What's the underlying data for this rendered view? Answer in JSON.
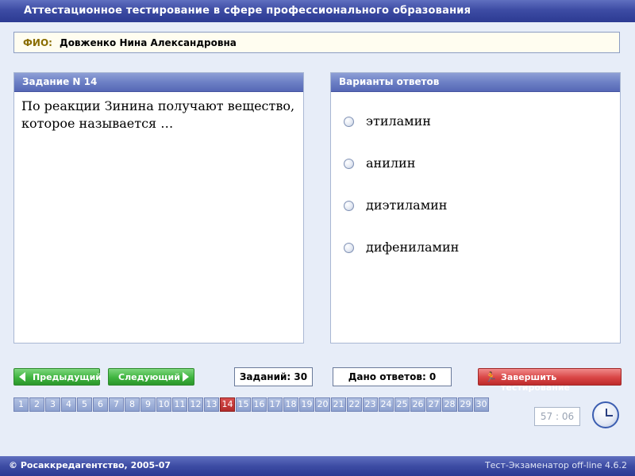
{
  "title": "Аттестационное тестирование в сфере профессионального образования",
  "fio": {
    "label": "ФИО:",
    "value": "Довженко Нина Александровна"
  },
  "question_panel": {
    "header": "Задание N 14",
    "text": "По реакции Зинина  получают вещество, которое называется …"
  },
  "answers_panel": {
    "header": "Варианты ответов",
    "options": [
      "этиламин",
      "анилин",
      "диэтиламин",
      "дифениламин"
    ]
  },
  "toolbar": {
    "prev_label": "Предыдущий",
    "next_label": "Следующий",
    "tasks_label": "Заданий: 30",
    "answered_label": "Дано ответов: 0",
    "finish_label": "Завершить тестирование"
  },
  "navigation": {
    "current": 14,
    "numbers": [
      "1",
      "2",
      "3",
      "4",
      "5",
      "6",
      "7",
      "8",
      "9",
      "10",
      "11",
      "12",
      "13",
      "14",
      "15",
      "16",
      "17",
      "18",
      "19",
      "20",
      "21",
      "22",
      "23",
      "24",
      "25",
      "26",
      "27",
      "28",
      "29",
      "30"
    ]
  },
  "timer": "57 : 06",
  "footer": {
    "copyright": "© Росаккредагентство, 2005-07",
    "version": "Тест-Экзаменатор off-line 4.6.2"
  },
  "colors": {
    "header_bar": "#3d4ca4",
    "panel_header": "#6d80c5",
    "button_green": "#3fb43f",
    "button_red": "#d94545",
    "current_number": "#b32a2a"
  },
  "icons": {
    "prev": "arrow-left-icon",
    "next": "arrow-right-icon",
    "finish": "runner-icon",
    "clock": "clock-icon"
  }
}
